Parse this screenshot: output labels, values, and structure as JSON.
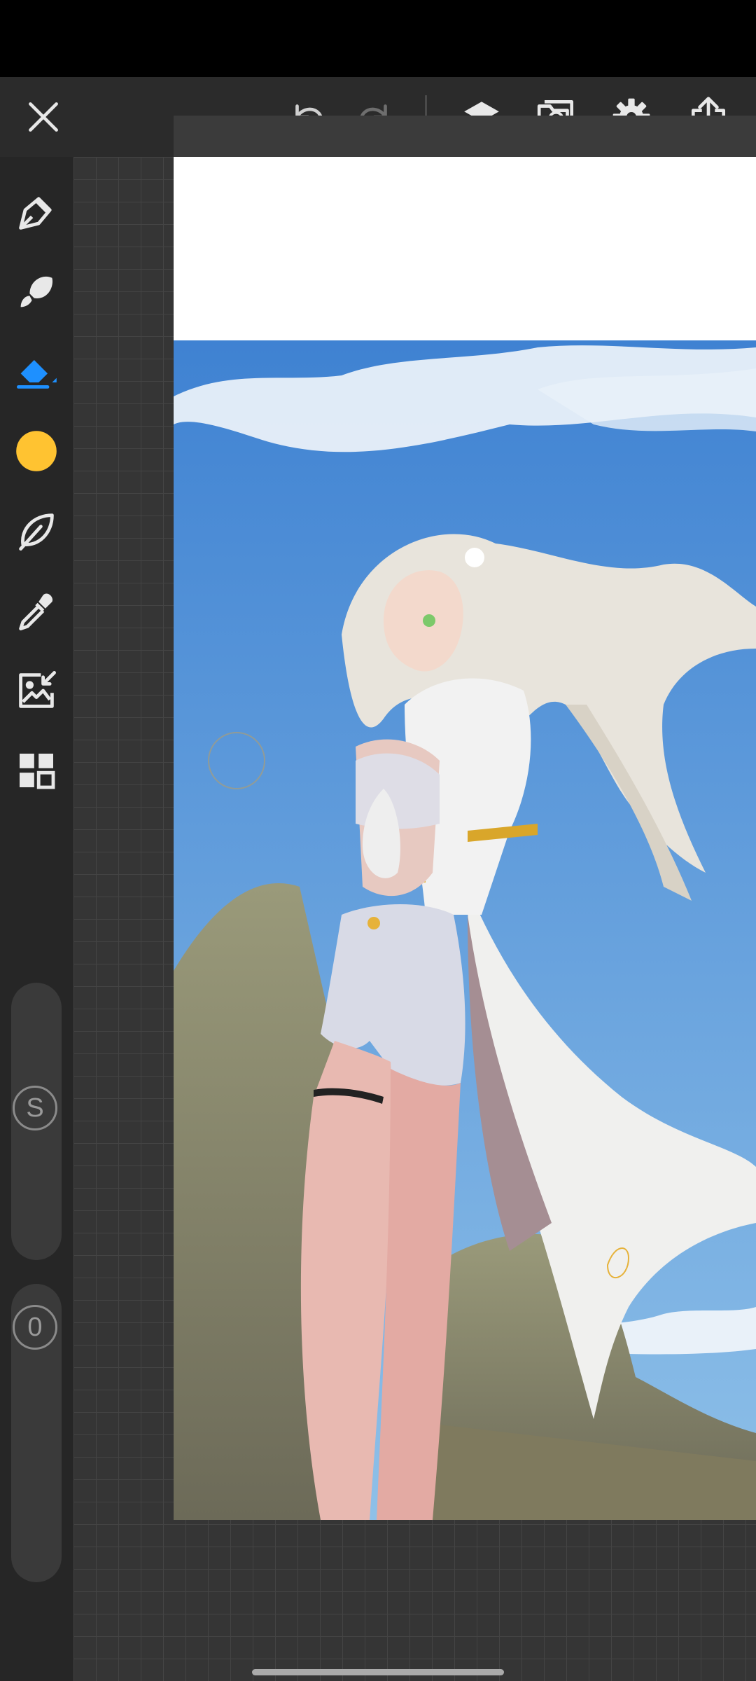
{
  "toolbar": {
    "icons": [
      "close-icon",
      "undo-icon",
      "redo-icon",
      "layers-icon",
      "gallery-icon",
      "settings-icon",
      "share-icon"
    ]
  },
  "sidebar": {
    "tools": [
      "pen-icon",
      "brush-icon",
      "eraser-icon",
      "color-swatch",
      "smudge-leaf-icon",
      "eyedropper-icon",
      "image-import-icon",
      "gallery-grid-icon"
    ],
    "selected_tool": "eraser",
    "current_color": "#FFC331",
    "size_slider_label": "S",
    "opacity_slider_label": "0"
  },
  "colors": {
    "accent": "#1E90FF",
    "toolbar_bg": "#2b2b2b",
    "sidebar_bg": "#262626"
  },
  "canvas": {
    "artwork_description_icon": "anime-elf-artwork"
  }
}
